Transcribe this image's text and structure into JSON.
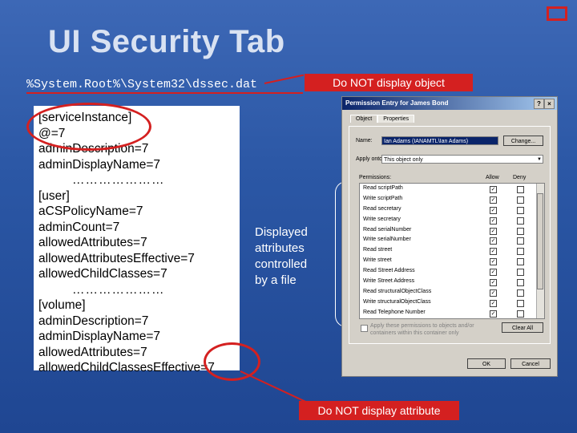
{
  "slide": {
    "title": "UI Security Tab",
    "path": "%System.Root%\\System32\\dssec.dat",
    "banner_top": "Do NOT display object",
    "banner_bottom": "Do NOT display attribute",
    "side_note": [
      "Displayed",
      "attributes",
      "controlled",
      "by a file"
    ],
    "accent_color": "#d42020",
    "background_color": "#2f5aa6"
  },
  "text_panel": {
    "lines": [
      "[serviceInstance]",
      "@=7",
      "adminDescription=7",
      "adminDisplayName=7",
      "…………………",
      "[user]",
      "aCSPolicyName=7",
      "adminCount=7",
      "allowedAttributes=7",
      "allowedAttributesEffective=7",
      "allowedChildClasses=7",
      "…………………",
      "[volume]",
      "adminDescription=7",
      "adminDisplayName=7",
      "allowedAttributes=7",
      "allowedChildClassesEffective=7"
    ]
  },
  "dialog": {
    "title": "Permission Entry for James Bond",
    "help_glyph": "?",
    "close_glyph": "×",
    "tabs": [
      "Object",
      "Properties"
    ],
    "name_label": "Name:",
    "name_value": "Ian Adams (IANAMTL\\Ian Adams)",
    "change_button": "Change...",
    "apply_onto_label": "Apply onto:",
    "apply_onto_value": "This object only",
    "permissions_label": "Permissions:",
    "allow_label": "Allow",
    "deny_label": "Deny",
    "permissions": [
      {
        "name": "Read scriptPath",
        "allow": true
      },
      {
        "name": "Write scriptPath",
        "allow": true
      },
      {
        "name": "Read secretary",
        "allow": true
      },
      {
        "name": "Write secretary",
        "allow": true
      },
      {
        "name": "Read serialNumber",
        "allow": true
      },
      {
        "name": "Write serialNumber",
        "allow": true
      },
      {
        "name": "Read street",
        "allow": true
      },
      {
        "name": "Write street",
        "allow": true
      },
      {
        "name": "Read Street Address",
        "allow": true
      },
      {
        "name": "Write Street Address",
        "allow": true
      },
      {
        "name": "Read structuralObjectClass",
        "allow": true
      },
      {
        "name": "Write structuralObjectClass",
        "allow": true
      },
      {
        "name": "Read Telephone Number",
        "allow": true
      }
    ],
    "apply_text": "Apply these permissions to objects and/or containers within this container only",
    "clear_all_button": "Clear All",
    "ok_button": "OK",
    "cancel_button": "Cancel",
    "check_glyph": "✓"
  }
}
